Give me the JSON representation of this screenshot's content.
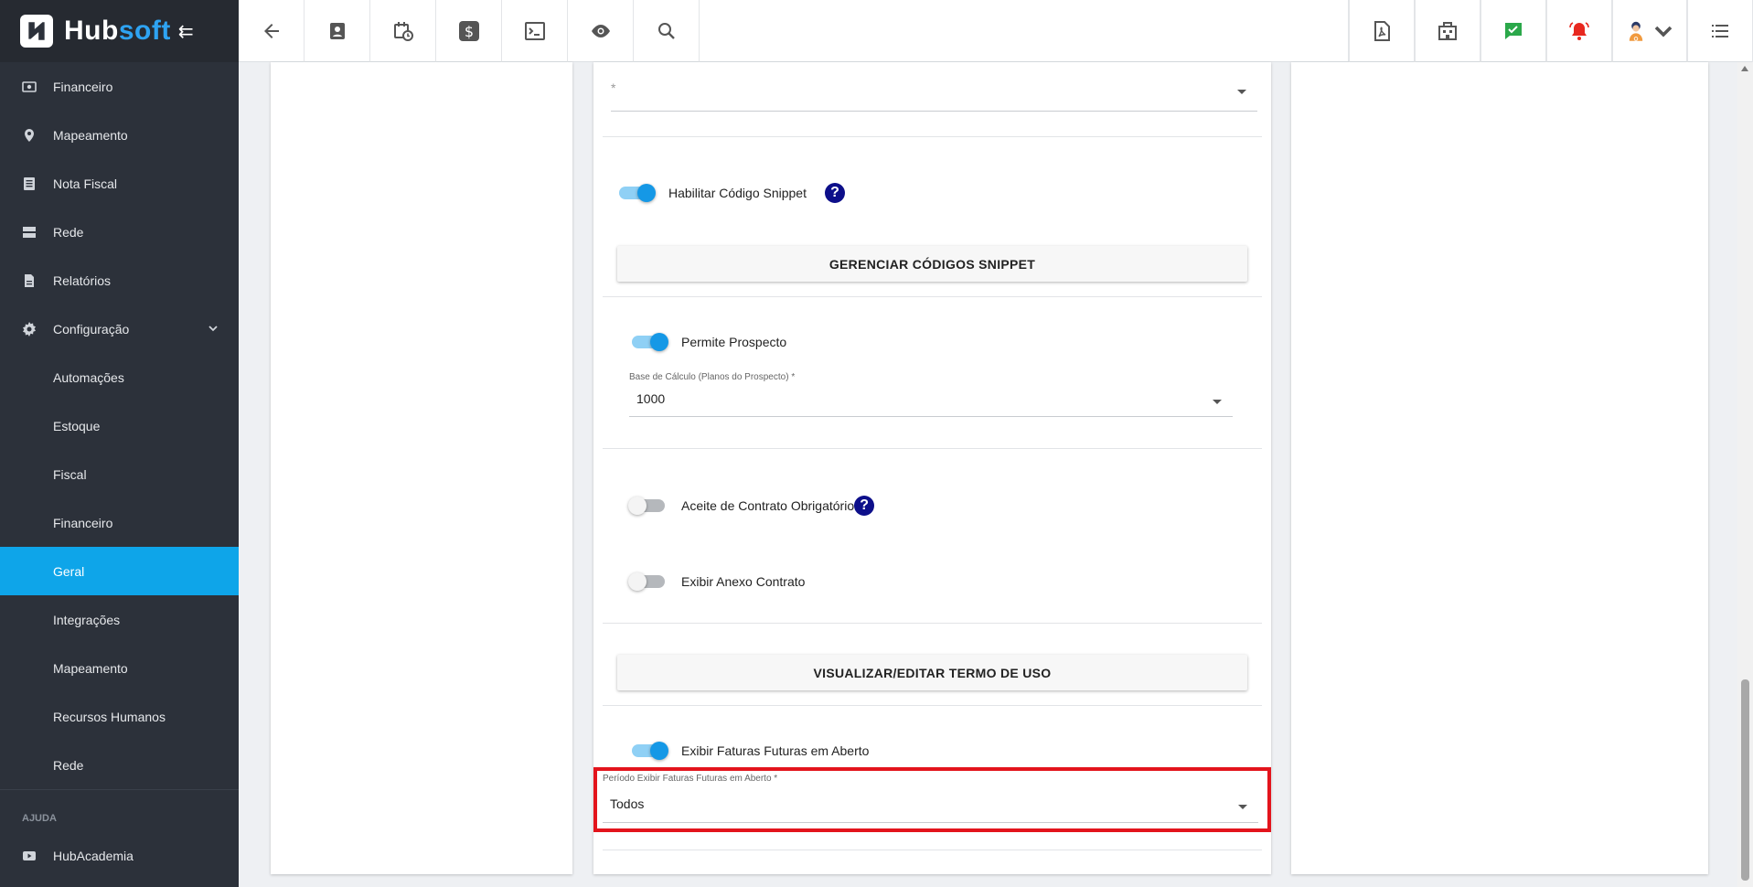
{
  "brand": {
    "name_main": "Hub",
    "name_accent": "soft"
  },
  "sidebar": {
    "items": [
      {
        "label": "Financeiro",
        "icon": "money-icon"
      },
      {
        "label": "Mapeamento",
        "icon": "map-pin-icon"
      },
      {
        "label": "Nota Fiscal",
        "icon": "document-icon"
      },
      {
        "label": "Rede",
        "icon": "server-icon"
      },
      {
        "label": "Relatórios",
        "icon": "report-icon"
      },
      {
        "label": "Configuração",
        "icon": "gear-icon"
      }
    ],
    "sub_items": [
      {
        "label": "Automações"
      },
      {
        "label": "Estoque"
      },
      {
        "label": "Fiscal"
      },
      {
        "label": "Financeiro"
      },
      {
        "label": "Geral",
        "active": true
      },
      {
        "label": "Integrações"
      },
      {
        "label": "Mapeamento"
      },
      {
        "label": "Recursos Humanos"
      },
      {
        "label": "Rede"
      }
    ],
    "section_label": "AJUDA",
    "help_items": [
      {
        "label": "HubAcademia",
        "icon": "video-icon"
      }
    ]
  },
  "topbar": {
    "left_icons": [
      "back-arrow-icon",
      "contact-card-icon",
      "calendar-clock-icon",
      "dollar-icon",
      "terminal-icon",
      "eye-icon",
      "search-icon"
    ],
    "right_icons": [
      "pdf-icon",
      "building-icon",
      "chat-check-icon",
      "alarm-bell-icon",
      "user-avatar",
      "list-menu-icon"
    ],
    "colors": {
      "chat": "#2ba84a",
      "alarm": "#e8281f"
    }
  },
  "form": {
    "top_select": {
      "value": "*"
    },
    "snippet": {
      "toggle_label": "Habilitar Código Snippet",
      "enabled": true,
      "button_label": "GERENCIAR CÓDIGOS SNIPPET"
    },
    "prospecto": {
      "toggle_label": "Permite Prospecto",
      "enabled": true,
      "select_label": "Base de Cálculo (Planos do Prospecto) *",
      "select_value": "1000"
    },
    "contrato": {
      "toggle_label": "Aceite de Contrato Obrigatório",
      "enabled": false
    },
    "anexo": {
      "toggle_label": "Exibir Anexo Contrato",
      "enabled": false
    },
    "termo_button_label": "VISUALIZAR/EDITAR TERMO DE USO",
    "faturas": {
      "toggle_label": "Exibir Faturas Futuras em Aberto",
      "enabled": true,
      "select_label": "Período Exibir Faturas Futuras em Aberto *",
      "select_value": "Todos"
    }
  },
  "colors": {
    "accent": "#0ea5e9",
    "sidebar_bg": "#2c313a",
    "highlight": "#e3141c",
    "toggle_on": "#1598e6",
    "help_icon": "#0d0f8a"
  }
}
